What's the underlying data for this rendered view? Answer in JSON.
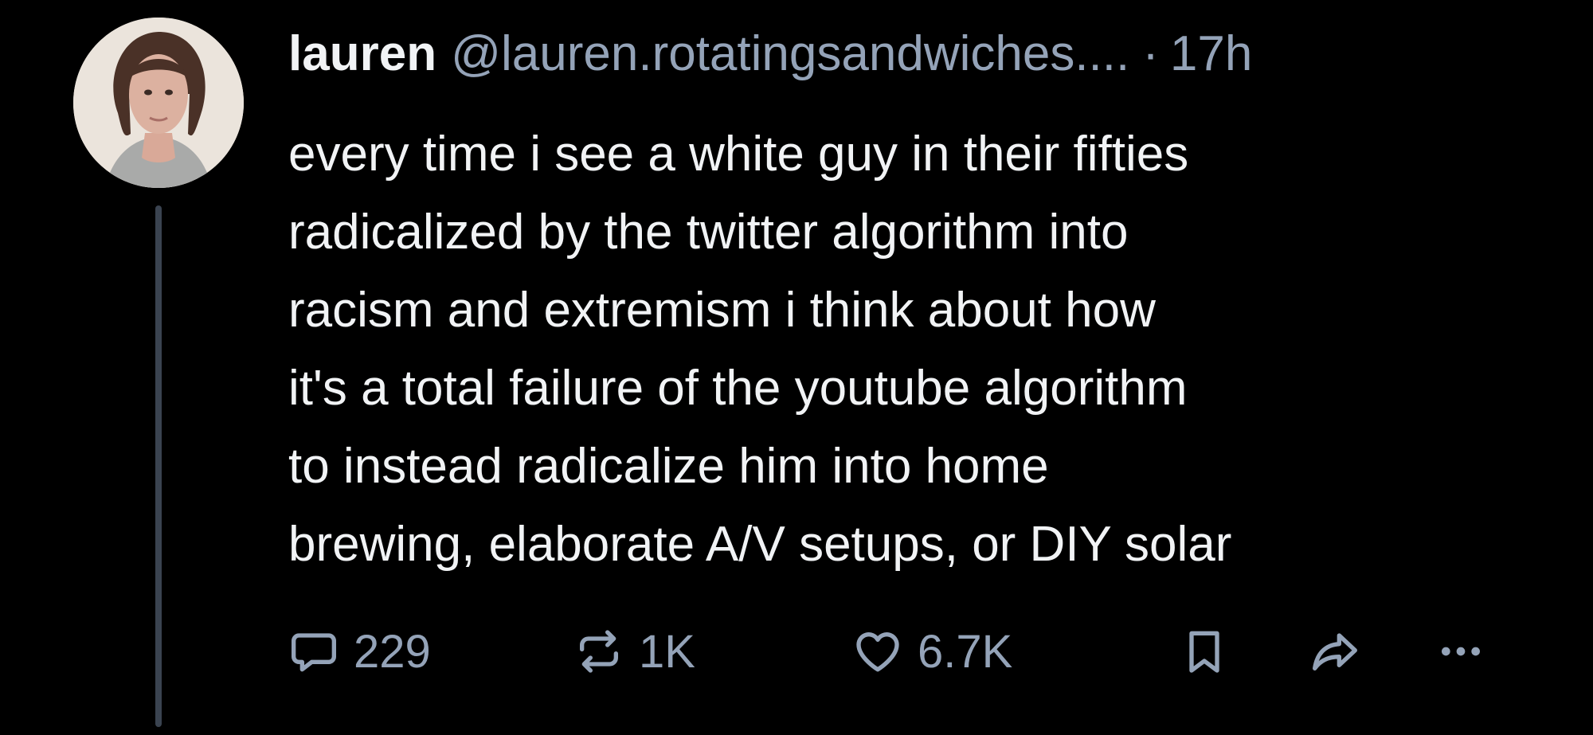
{
  "post": {
    "author": {
      "display_name": "lauren",
      "handle": "@lauren.rotatingsandwiches....",
      "avatar_icon": "profile-photo"
    },
    "separator": "·",
    "timestamp": "17h",
    "text_lines": [
      "every time i see a white guy in their fifties",
      "radicalized by the twitter algorithm into",
      "racism and extremism i think about how",
      "it's a total failure of the youtube algorithm",
      "to instead radicalize him into home",
      "brewing, elaborate A/V setups, or DIY solar"
    ],
    "actions": {
      "reply": {
        "icon": "reply-bubble-icon",
        "count": "229"
      },
      "repost": {
        "icon": "repost-arrows-icon",
        "count": "1K"
      },
      "like": {
        "icon": "heart-icon",
        "count": "6.7K"
      },
      "bookmark": {
        "icon": "bookmark-icon"
      },
      "share": {
        "icon": "share-arrow-icon"
      },
      "more": {
        "icon": "more-dots-icon"
      }
    }
  },
  "colors": {
    "background": "#000000",
    "primary_text": "#f1f3f5",
    "secondary_text": "#94a3b8",
    "thread_line": "#3a4350"
  }
}
